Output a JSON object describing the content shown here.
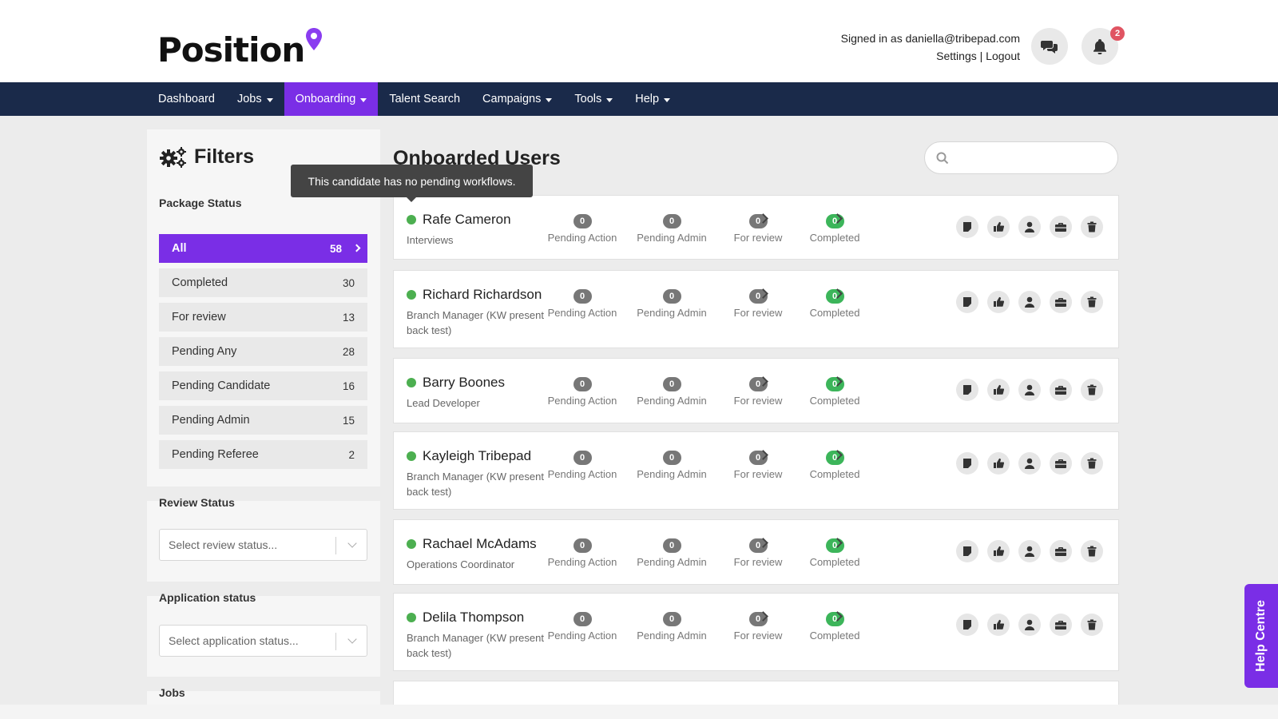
{
  "brand": {
    "name": "Position",
    "accent": "#7a2ee6",
    "nav_bg": "#1a2a4a"
  },
  "header": {
    "signed_in": "Signed in as daniella@tribepad.com",
    "settings": "Settings",
    "separator": "|",
    "logout": "Logout",
    "notification_count": "2"
  },
  "nav": [
    {
      "label": "Dashboard",
      "has_caret": false
    },
    {
      "label": "Jobs",
      "has_caret": true
    },
    {
      "label": "Onboarding",
      "has_caret": true,
      "active": true
    },
    {
      "label": "Talent Search",
      "has_caret": false
    },
    {
      "label": "Campaigns",
      "has_caret": true
    },
    {
      "label": "Tools",
      "has_caret": true
    },
    {
      "label": "Help",
      "has_caret": true
    }
  ],
  "filters": {
    "title": "Filters",
    "package_status_label": "Package Status",
    "statuses": [
      {
        "label": "All",
        "count": "58",
        "active": true
      },
      {
        "label": "Completed",
        "count": "30"
      },
      {
        "label": "For review",
        "count": "13"
      },
      {
        "label": "Pending Any",
        "count": "28"
      },
      {
        "label": "Pending Candidate",
        "count": "16"
      },
      {
        "label": "Pending Admin",
        "count": "15"
      },
      {
        "label": "Pending Referee",
        "count": "2"
      }
    ],
    "review_status_label": "Review Status",
    "review_status_placeholder": "Select review status...",
    "application_status_label": "Application status",
    "application_status_placeholder": "Select application status...",
    "jobs_label": "Jobs"
  },
  "main": {
    "title": "Onboarded Users",
    "tooltip": "This candidate has no pending workflows.",
    "metric_labels": [
      "Pending Action",
      "Pending Admin",
      "For review",
      "Completed"
    ],
    "users": [
      {
        "name": "Rafe Cameron",
        "role": "Interviews",
        "counts": [
          "0",
          "0",
          "0",
          "0"
        ]
      },
      {
        "name": "Richard Richardson",
        "role": "Branch Manager (KW present back test)",
        "counts": [
          "0",
          "0",
          "0",
          "0"
        ]
      },
      {
        "name": "Barry Boones",
        "role": "Lead Developer",
        "counts": [
          "0",
          "0",
          "0",
          "0"
        ]
      },
      {
        "name": "Kayleigh Tribepad",
        "role": "Branch Manager (KW present back test)",
        "counts": [
          "0",
          "0",
          "0",
          "0"
        ]
      },
      {
        "name": "Rachael McAdams",
        "role": "Operations Coordinator",
        "counts": [
          "0",
          "0",
          "0",
          "0"
        ]
      },
      {
        "name": "Delila Thompson",
        "role": "Branch Manager (KW present back test)",
        "counts": [
          "0",
          "0",
          "0",
          "0"
        ]
      }
    ]
  },
  "help_centre": "Help Centre"
}
